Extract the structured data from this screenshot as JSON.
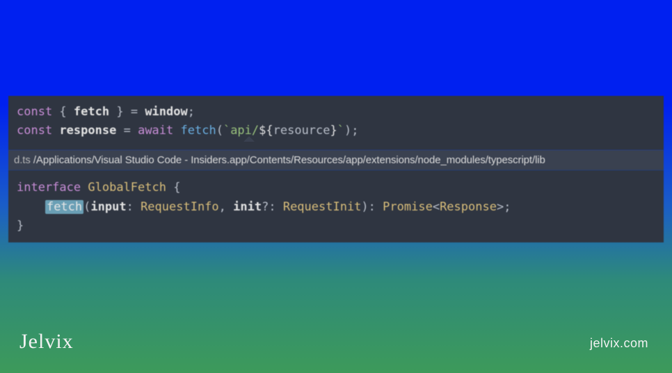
{
  "code_top": {
    "tokens": [
      [
        [
          "kw",
          "const"
        ],
        [
          "pln",
          " { "
        ],
        [
          "id",
          "fetch"
        ],
        [
          "pln",
          " } "
        ],
        [
          "op",
          "="
        ],
        [
          "pln",
          " "
        ],
        [
          "id",
          "window"
        ],
        [
          "pln",
          ";"
        ]
      ],
      [
        [
          "kw",
          "const"
        ],
        [
          "pln",
          " "
        ],
        [
          "id",
          "response"
        ],
        [
          "pln",
          " "
        ],
        [
          "op",
          "="
        ],
        [
          "pln",
          " "
        ],
        [
          "kw",
          "await"
        ],
        [
          "pln",
          " "
        ],
        [
          "fn",
          "fetch"
        ],
        [
          "pln",
          "("
        ],
        [
          "str",
          "`api/"
        ],
        [
          "tpl",
          "${"
        ],
        [
          "pln",
          "resource"
        ],
        [
          "tpl",
          "}"
        ],
        [
          "str",
          "`"
        ],
        [
          "pln",
          ");"
        ]
      ]
    ]
  },
  "path_bar": {
    "file_tag": "d.ts",
    "path": " /Applications/Visual Studio Code - Insiders.app/Contents/Resources/app/extensions/node_modules/typescript/lib"
  },
  "code_bottom": {
    "tokens": [
      [
        [
          "kw",
          "interface"
        ],
        [
          "pln",
          " "
        ],
        [
          "type",
          "GlobalFetch"
        ],
        [
          "pln",
          " {"
        ]
      ],
      [
        [
          "pln",
          "    "
        ],
        [
          "highlight",
          "fetch"
        ],
        [
          "pln",
          "("
        ],
        [
          "id",
          "input"
        ],
        [
          "pln",
          ": "
        ],
        [
          "type",
          "RequestInfo"
        ],
        [
          "pln",
          ", "
        ],
        [
          "id",
          "init"
        ],
        [
          "op",
          "?"
        ],
        [
          "pln",
          ": "
        ],
        [
          "type",
          "RequestInit"
        ],
        [
          "pln",
          ")"
        ],
        [
          "pln",
          ": "
        ],
        [
          "type",
          "Promise"
        ],
        [
          "pln",
          "<"
        ],
        [
          "type",
          "Response"
        ],
        [
          "pln",
          ">;"
        ]
      ],
      [
        [
          "pln",
          "}"
        ]
      ]
    ]
  },
  "brand": {
    "name": "Jelvix",
    "site": "jelvix.com"
  }
}
